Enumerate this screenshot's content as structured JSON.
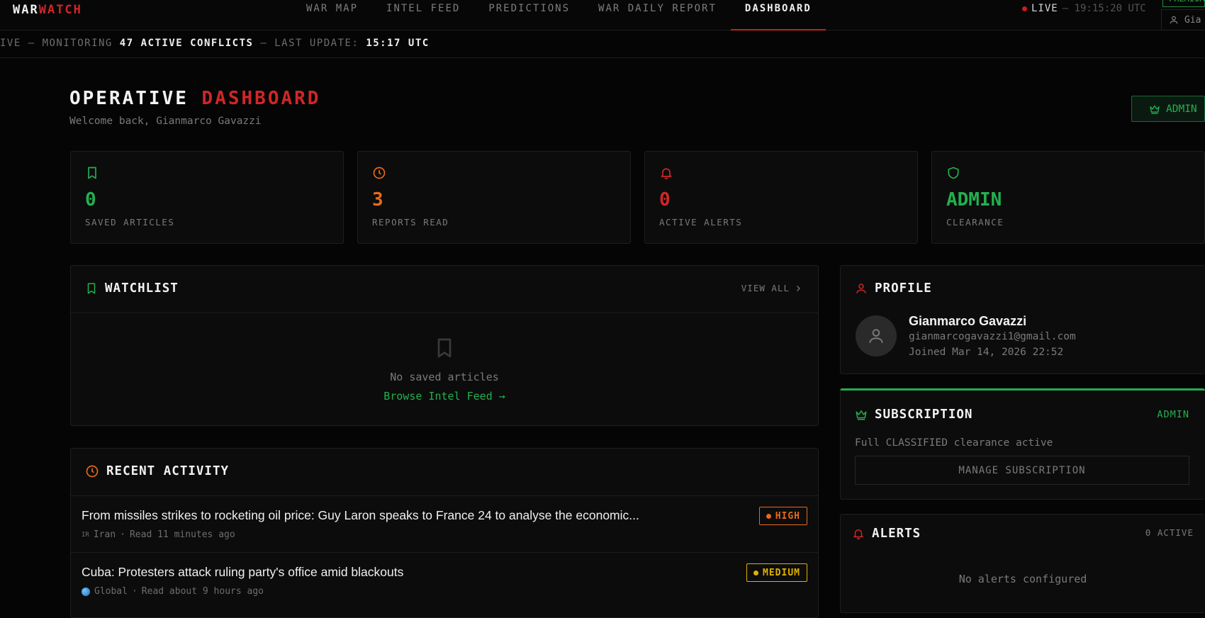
{
  "logo": {
    "part1": "WAR",
    "part2": "WATCH"
  },
  "nav": {
    "items": [
      {
        "label": "WAR MAP"
      },
      {
        "label": "INTEL FEED"
      },
      {
        "label": "PREDICTIONS"
      },
      {
        "label": "WAR DAILY REPORT"
      },
      {
        "label": "DASHBOARD"
      }
    ],
    "active": "DASHBOARD"
  },
  "live": {
    "label": "LIVE",
    "time": "— 19:15:20 UTC"
  },
  "premium_tag": "PREMIUM",
  "user_chip": "Gia",
  "ticker": {
    "prefix": "IVE — MONITORING ",
    "conflicts": "47 ACTIVE CONFLICTS",
    "middle": " — LAST UPDATE: ",
    "update": "15:17 UTC"
  },
  "header": {
    "title_part1": "OPERATIVE ",
    "title_part2": "DASHBOARD",
    "welcome": "Welcome back, Gianmarco Gavazzi",
    "admin_button": "ADMIN"
  },
  "stats": [
    {
      "value": "0",
      "label": "SAVED ARTICLES",
      "icon": "bookmark-icon",
      "color": "#22b04f"
    },
    {
      "value": "3",
      "label": "REPORTS READ",
      "icon": "clock-icon",
      "color": "#e86a1a"
    },
    {
      "value": "0",
      "label": "ACTIVE ALERTS",
      "icon": "bell-icon",
      "color": "#d12626"
    },
    {
      "value": "ADMIN",
      "label": "CLEARANCE",
      "icon": "shield-icon",
      "color": "#22b04f"
    }
  ],
  "watchlist": {
    "title": "WATCHLIST",
    "view_all": "VIEW ALL",
    "empty_text": "No saved articles",
    "browse_link": "Browse Intel Feed →"
  },
  "recent_activity": {
    "title": "RECENT ACTIVITY",
    "items": [
      {
        "title": "From missiles strikes to rocketing oil price: Guy Laron speaks to France 24 to analyse the economic...",
        "flag": "IR",
        "region": "Iran",
        "read": "Read 11 minutes ago",
        "severity": "HIGH",
        "severity_color": "#e86a1a"
      },
      {
        "title": "Cuba: Protesters attack ruling party's office amid blackouts",
        "flag": "globe",
        "region": "Global",
        "read": "Read about 9 hours ago",
        "severity": "MEDIUM",
        "severity_color": "#e0b100"
      }
    ]
  },
  "profile": {
    "title": "PROFILE",
    "name": "Gianmarco Gavazzi",
    "email": "gianmarcogavazzi1@gmail.com",
    "joined": "Joined Mar 14, 2026 22:52"
  },
  "subscription": {
    "title": "SUBSCRIPTION",
    "tier": "ADMIN",
    "status": "Full CLASSIFIED clearance active",
    "manage_button": "MANAGE SUBSCRIPTION"
  },
  "alerts": {
    "title": "ALERTS",
    "count": "0 ACTIVE",
    "empty_text": "No alerts configured"
  }
}
